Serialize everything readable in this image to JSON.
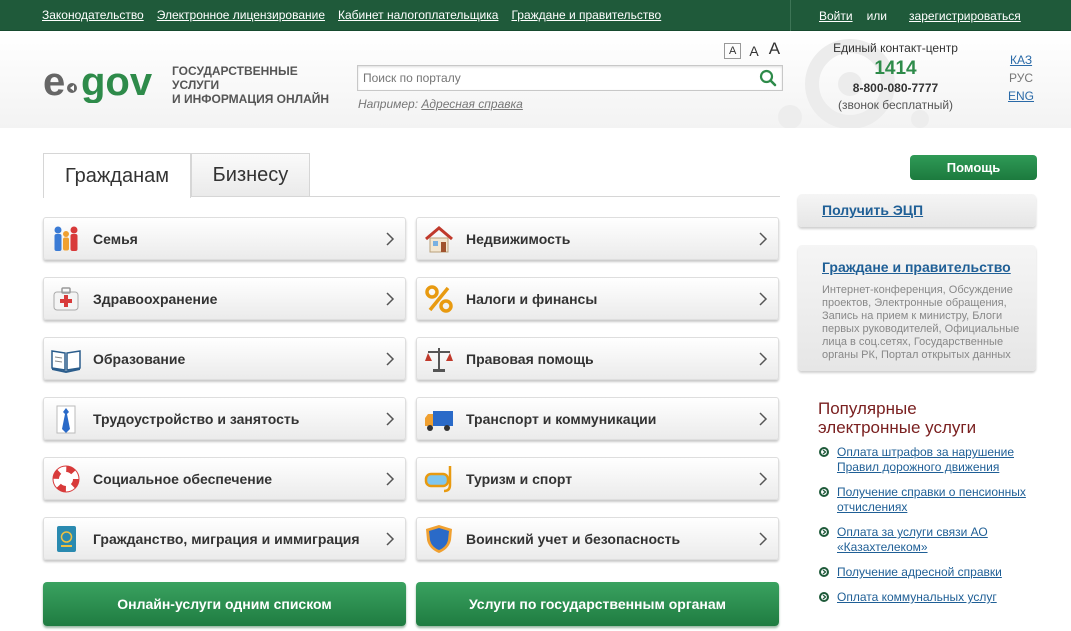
{
  "topbar": {
    "links": [
      "Законодательство",
      "Электронное лицензирование",
      "Кабинет налогоплательщика",
      "Граждане и правительство"
    ],
    "login": "Войти",
    "or": "или",
    "register": "зарегистрироваться"
  },
  "header": {
    "tagline_line1": "ГОСУДАРСТВЕННЫЕ УСЛУГИ",
    "tagline_line2": "И ИНФОРМАЦИЯ ОНЛАЙН",
    "font_small": "A",
    "font_medium": "A",
    "font_large": "A",
    "search_placeholder": "Поиск по порталу",
    "example_prefix": "Например:",
    "example_link": "Адресная справка",
    "contact_title": "Единый контакт-центр",
    "contact_short": "1414",
    "contact_phone": "8-800-080-7777",
    "contact_note": "(звонок бесплатный)",
    "languages": [
      "КАЗ",
      "РУС",
      "ENG"
    ],
    "active_language": "РУС"
  },
  "tabs": [
    {
      "label": "Гражданам",
      "active": true
    },
    {
      "label": "Бизнесу",
      "active": false
    }
  ],
  "services_left": [
    {
      "label": "Семья",
      "icon": "family-icon"
    },
    {
      "label": "Здравоохранение",
      "icon": "first-aid-icon"
    },
    {
      "label": "Образование",
      "icon": "book-icon"
    },
    {
      "label": "Трудоустройство и занятость",
      "icon": "tie-icon"
    },
    {
      "label": "Социальное обеспечение",
      "icon": "lifebuoy-icon"
    },
    {
      "label": "Гражданство, миграция и иммиграция",
      "icon": "passport-icon"
    }
  ],
  "services_right": [
    {
      "label": "Недвижимость",
      "icon": "house-icon"
    },
    {
      "label": "Налоги и финансы",
      "icon": "percent-icon"
    },
    {
      "label": "Правовая помощь",
      "icon": "scales-icon"
    },
    {
      "label": "Транспорт и коммуникации",
      "icon": "truck-icon"
    },
    {
      "label": "Туризм и спорт",
      "icon": "diving-mask-icon"
    },
    {
      "label": "Воинский учет и безопасность",
      "icon": "shield-icon"
    }
  ],
  "buttons": {
    "online_list": "Онлайн-услуги одним списком",
    "by_agency": "Услуги по государственным органам",
    "help": "Помощь"
  },
  "sidebar": {
    "ecp_link": "Получить ЭЦП",
    "citgov_title": "Граждане и правительство",
    "citgov_desc": "Интернет-конференция, Обсуждение проектов, Электронные обращения, Запись на прием к министру, Блоги первых руководителей, Официальные лица в соц.сетях, Государственные органы РК, Портал открытых данных",
    "popular_title_line1": "Популярные",
    "popular_title_line2": "электронные услуги",
    "popular": [
      "Оплата штрафов за нарушение Правил дорожного движения",
      "Получение справки о пенсионных отчислениях",
      "Оплата за услуги связи АО «Казахтелеком»",
      "Получение адресной справки",
      "Оплата коммунальных услуг"
    ]
  },
  "colors": {
    "brand_green": "#1f5a3a",
    "accent_green": "#2e8b4a",
    "link_blue": "#1f5f96",
    "popular_title": "#7a2020"
  }
}
